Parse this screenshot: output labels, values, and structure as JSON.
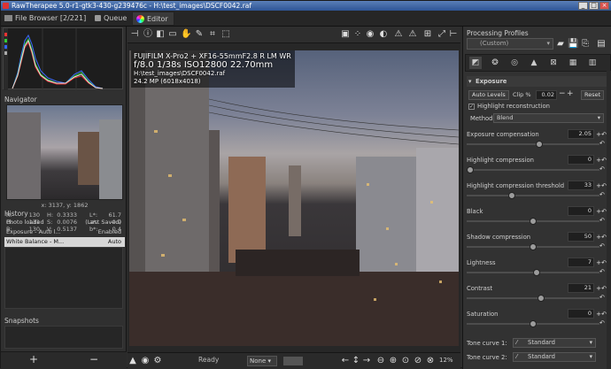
{
  "window": {
    "title": "RawTherapee 5.0-r1-gtk3-430-g239476c - H:\\test_images\\DSCF0042.raf"
  },
  "tabs": {
    "file_browser": "File Browser [2/221]",
    "queue": "Queue",
    "editor": "Editor"
  },
  "left": {
    "navigator": "Navigator",
    "coords": "x: 3137, y: 1862",
    "readout": {
      "r": "130",
      "g": "131",
      "b": "130",
      "h": "0.3333",
      "s": "0.0076",
      "v": "0.5137",
      "l": "61.7",
      "a": "-0.9",
      "bs": "0.4"
    },
    "history_title": "History",
    "history": [
      {
        "name": "Photo loaded",
        "value": "(Last Saved)"
      },
      {
        "name": "Exposure - Auto l...",
        "value": "Enabled"
      },
      {
        "name": "White Balance - M...",
        "value": "Auto"
      }
    ],
    "snapshots": "Snapshots",
    "add": "+",
    "remove": "−"
  },
  "photo": {
    "line1": "FUJIFILM X-Pro2 + XF16-55mmF2.8 R LM WR",
    "line2": "f/8.0  1/38s  ISO12800  22.70mm",
    "line3": "H:\\test_images\\DSCF0042.raf",
    "line4": "24.2 MP (6018x4018)"
  },
  "statusbar": {
    "ready": "Ready",
    "select": "None",
    "zoom": "12%"
  },
  "right": {
    "profiles_title": "Processing Profiles",
    "profile": "(Custom)",
    "exposure_title": "Exposure",
    "auto_levels": "Auto Levels",
    "clip_label": "Clip %",
    "clip_val": "0.02",
    "reset": "Reset",
    "highlight_recon": "Highlight reconstruction",
    "method_label": "Method:",
    "method_val": "Blend",
    "controls": [
      {
        "label": "Exposure compensation",
        "value": "2.05",
        "pos": 0.55
      },
      {
        "label": "Highlight compression",
        "value": "0",
        "pos": 0.0
      },
      {
        "label": "Highlight compression threshold",
        "value": "33",
        "pos": 0.33
      },
      {
        "label": "Black",
        "value": "0",
        "pos": 0.5
      },
      {
        "label": "Shadow compression",
        "value": "50",
        "pos": 0.5
      },
      {
        "label": "Lightness",
        "value": "7",
        "pos": 0.53
      },
      {
        "label": "Contrast",
        "value": "21",
        "pos": 0.56
      },
      {
        "label": "Saturation",
        "value": "0",
        "pos": 0.5
      }
    ],
    "tone1_label": "Tone curve 1:",
    "tone1_val": "Standard",
    "tone2_label": "Tone curve 2:",
    "tone2_val": "Standard"
  }
}
